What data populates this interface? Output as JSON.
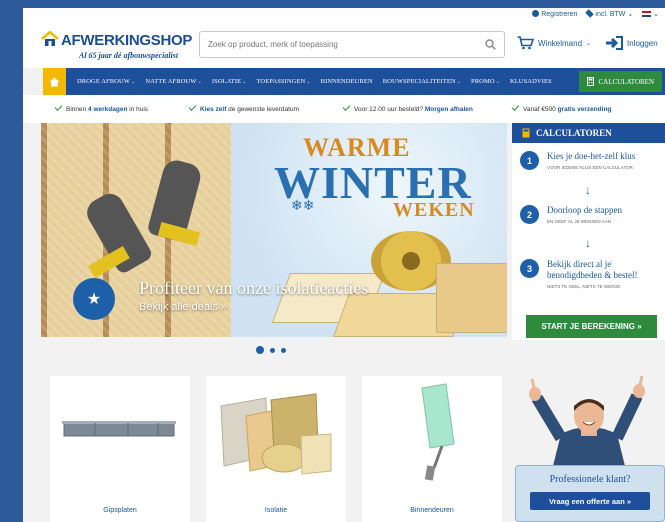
{
  "utility": {
    "register": "Registreren",
    "vat": "incl. BTW"
  },
  "logo": {
    "brand": "AFWERKINGSHOP",
    "tagline": "Al 65 jaar dé afbouwspecialist"
  },
  "search": {
    "placeholder": "Zoek op product, merk of toepassing"
  },
  "header": {
    "cart_label": "Winkelmand",
    "login_label": "Inloggen"
  },
  "nav": {
    "items": [
      {
        "label": "DROGE AFBOUW"
      },
      {
        "label": "NATTE AFBOUW"
      },
      {
        "label": "ISOLATIE"
      },
      {
        "label": "TOEPASSINGEN"
      },
      {
        "label": "BINNENDEUREN"
      },
      {
        "label": "BOUWSPECIALITEITEN"
      },
      {
        "label": "PROMO"
      },
      {
        "label": "KLUSADVIES"
      }
    ],
    "calculator": "CALCULATOREN"
  },
  "usp": [
    {
      "pre": "Binnen ",
      "bold": "4 werkdagen",
      "post": " in huis"
    },
    {
      "pre": "",
      "bold": "Kies zelf",
      "post": " de gewenste leverdatum"
    },
    {
      "pre": "Voor 12.00 uur besteld? ",
      "bold": "Morgen afhalen",
      "post": ""
    },
    {
      "pre": "Vanaf €500 ",
      "bold": "gratis verzending",
      "post": ""
    }
  ],
  "hero": {
    "headline_1": "WARME",
    "headline_2": "WINTER",
    "headline_3": "WEKEN",
    "title": "Profiteer van onze isolatieacties",
    "subtitle": "Bekijk alle deals »"
  },
  "calculator_panel": {
    "title": "CALCULATOREN",
    "steps": [
      {
        "num": "1",
        "title": "Kies je doe-het-zelf klus",
        "sub": "Voor iedere klus een calculator"
      },
      {
        "num": "2",
        "title": "Doorloop de stappen",
        "sub": "En geef al je wensen aan"
      },
      {
        "num": "3",
        "title": "Bekijk direct al je benodigdheden & bestel!",
        "sub": "Niets te veel, niets te weinig"
      }
    ],
    "cta": "START JE BEREKENING »"
  },
  "categories": [
    {
      "label": "Gipsplaten"
    },
    {
      "label": "Isolatie"
    },
    {
      "label": "Binnendeuren"
    }
  ],
  "promo": {
    "question": "Professionele klant?",
    "button": "Vraag een offerte aan »"
  },
  "colors": {
    "primary": "#1d4f9a",
    "accent_yellow": "#f5b800",
    "green": "#2e8b3d",
    "orange": "#d98a1f"
  }
}
